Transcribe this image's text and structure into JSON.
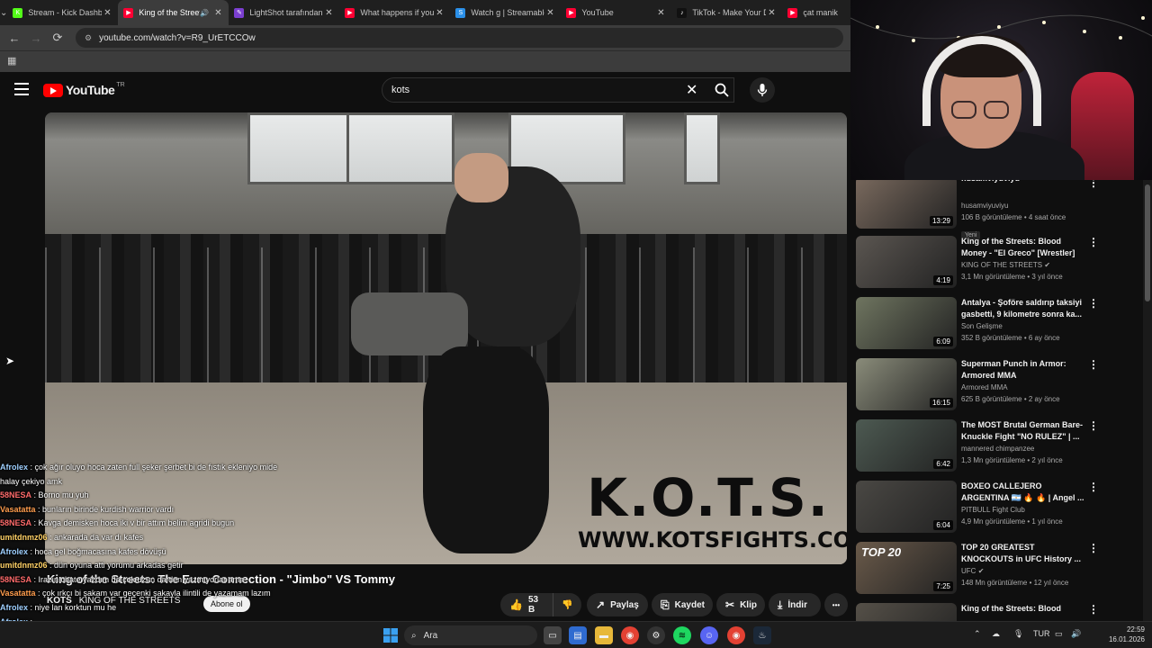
{
  "browser": {
    "tabs": [
      {
        "title": "Stream - Kick Dashboard",
        "favicon_color": "#53fc18",
        "favicon_glyph": "K",
        "active": false
      },
      {
        "title": "King of the Streets",
        "favicon_color": "#ff0033",
        "favicon_glyph": "▶",
        "active": true,
        "audio": true
      },
      {
        "title": "LightShot tarafından",
        "favicon_color": "#7b3fd0",
        "favicon_glyph": "✎",
        "active": false
      },
      {
        "title": "What happens if you",
        "favicon_color": "#ff0033",
        "favicon_glyph": "▶",
        "active": false
      },
      {
        "title": "Watch g | Streamable",
        "favicon_color": "#2a8fe8",
        "favicon_glyph": "S",
        "active": false
      },
      {
        "title": "YouTube",
        "favicon_color": "#ff0033",
        "favicon_glyph": "▶",
        "active": false
      },
      {
        "title": "TikTok - Make Your D",
        "favicon_color": "#111111",
        "favicon_glyph": "♪",
        "active": false
      },
      {
        "title": "çat manik",
        "favicon_color": "#ff0033",
        "favicon_glyph": "▶",
        "active": false
      }
    ],
    "url": "youtube.com/watch?v=R9_UrETCCOw"
  },
  "youtube": {
    "logo_text": "YouTube",
    "region": "TR",
    "search_query": "kots",
    "video": {
      "watermark_title": "K.O.T.S.",
      "watermark_url": "WWW.KOTSFIGHTS.COM",
      "title": "King of the Streets: The Euro Connection - \"Jimbo\" VS Tommy",
      "channel": "KING OF THE STREETS",
      "channel_short": "KOTS",
      "subscribe_label": "Abone ol",
      "likes": "53 B",
      "share_label": "Paylaş",
      "save_label": "Kaydet",
      "clip_label": "Klip",
      "download_label": "İndir",
      "more_label": "•••"
    },
    "recommendations": [
      {
        "title": "husamviyuviyu",
        "channel": "husamviyuviyu",
        "views": "106 B görüntüleme",
        "age": "4 saat önce",
        "duration": "13:29",
        "badge": "Yeni",
        "thumb": "#7a6a5e"
      },
      {
        "title": "King of the Streets: Blood Money - \"El Greco\" [Wrestler] V...",
        "channel": "KING OF THE STREETS",
        "verified": true,
        "views": "3,1 Mn görüntüleme",
        "age": "3 yıl önce",
        "duration": "4:19",
        "thumb": "#5b5651"
      },
      {
        "title": "Antalya - Şoföre saldırıp taksiyi gasbetti, 9 kilometre sonra ka...",
        "channel": "Son Gelişme",
        "views": "352 B görüntüleme",
        "age": "6 ay önce",
        "duration": "6:09",
        "thumb": "#6f7560"
      },
      {
        "title": "Superman Punch in Armor: Armored MMA",
        "channel": "Armored MMA",
        "views": "625 B görüntüleme",
        "age": "2 ay önce",
        "duration": "16:15",
        "thumb": "#8a8c7a"
      },
      {
        "title": "The MOST Brutal German Bare-Knuckle Fight \"NO RULEZ\" | ...",
        "channel": "mannered chimpanzee",
        "views": "1,3 Mn görüntüleme",
        "age": "2 yıl önce",
        "duration": "6:42",
        "thumb": "#4d5a52"
      },
      {
        "title": "BOXEO CALLEJERO ARGENTINA 🇦🇷 🔥 🔥 | Angel ...",
        "channel": "PITBULL Fight Club",
        "views": "4,9 Mn görüntüleme",
        "age": "1 yıl önce",
        "duration": "6:04",
        "thumb": "#4a4844"
      },
      {
        "title": "TOP 20 GREATEST KNOCKOUTS in UFC History ...",
        "channel": "UFC",
        "verified": true,
        "views": "148 Mn görüntüleme",
        "age": "12 yıl önce",
        "duration": "7:25",
        "thumb": "#6a5a4a",
        "thumb_text": "TOP 20"
      },
      {
        "title": "King of the Streets: Blood",
        "channel": "",
        "views": "",
        "age": "",
        "duration": "",
        "thumb": "#555048"
      }
    ]
  },
  "chat": [
    {
      "user": "Afrolex",
      "color": "#9fd0ff",
      "msg": "çok ağır oluyo hoca zaten full şeker şerbet bi de fıstık ekleniyo mide"
    },
    {
      "user": "",
      "color": "#ffffff",
      "msg": "halay çekiyo amk"
    },
    {
      "user": "58NESA",
      "color": "#ff6b6b",
      "msg": "Borno mu yuh"
    },
    {
      "user": "Vasatatta",
      "color": "#ff9d4d",
      "msg": "bunların birinde kurdish warrior vardı"
    },
    {
      "user": "58NESA",
      "color": "#ff6b6b",
      "msg": "Kavga demisken hoca iki v bir attım belim agridi bugun"
    },
    {
      "user": "umitdnmz06",
      "color": "#ffd166",
      "msg": "ankarada da var dı kafes"
    },
    {
      "user": "Afrolex",
      "color": "#9fd0ff",
      "msg": "hoca gel boğmacasına kafes dövüşü"
    },
    {
      "user": "umitdnmz06",
      "color": "#ffd166",
      "msg": "dün oyuna atti yorumu arkadas getir"
    },
    {
      "user": "58NESA",
      "color": "#ff6b6b",
      "msg": "Irazın chate yazdım da çok uzun da den yazmıyorlar ama"
    },
    {
      "user": "Vasatatta",
      "color": "#ff9d4d",
      "msg": "çok ırkçı bi şakam var geçenki şakayla ilintili de yazamam lazım"
    },
    {
      "user": "Afrolex",
      "color": "#9fd0ff",
      "msg": "niye lan korktun mu he"
    },
    {
      "user": "Afrolex",
      "color": "#9fd0ff",
      "msg": ""
    }
  ],
  "taskbar": {
    "search_placeholder": "Ara",
    "language": "TUR",
    "time": "22:59",
    "date": "16.01.2026"
  }
}
